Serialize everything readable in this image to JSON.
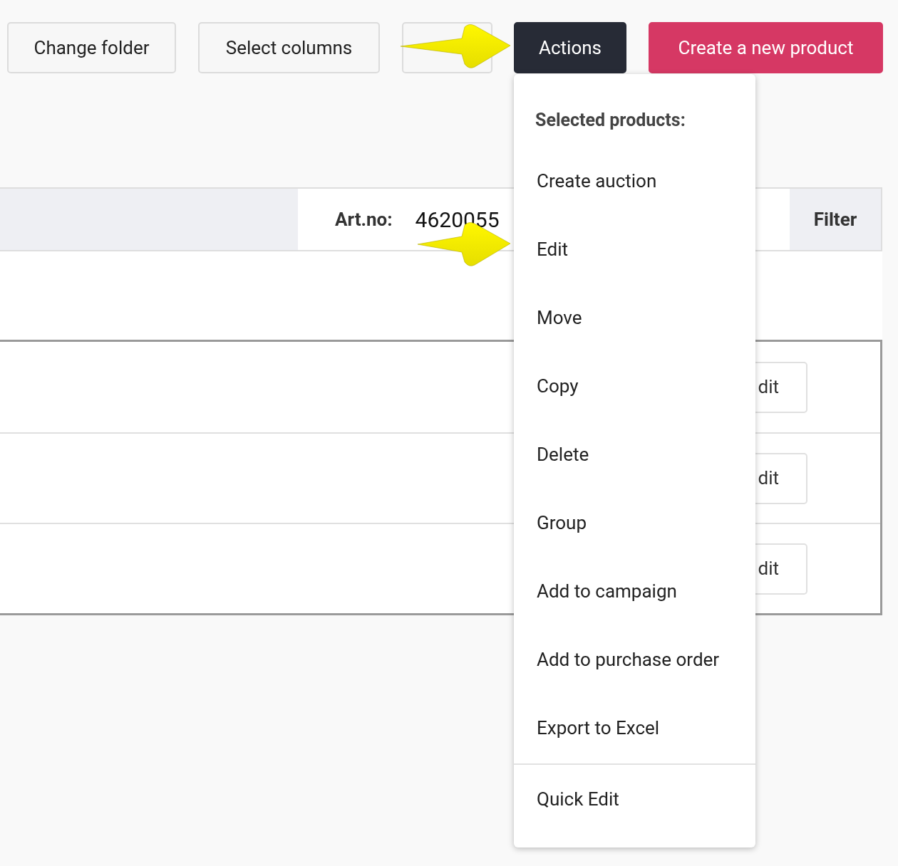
{
  "toolbar": {
    "buttons": [
      {
        "label": "Change folder",
        "kind": "plain"
      },
      {
        "label": "Select columns",
        "kind": "plain"
      },
      {
        "kind": "covered"
      },
      {
        "label": "Actions",
        "kind": "dark"
      },
      {
        "label": "Create a new product",
        "kind": "primary"
      }
    ]
  },
  "filter_bar": {
    "field_label": "Art.no:",
    "field_value": "4620055",
    "button": "Filter"
  },
  "table": {
    "rows": [
      {
        "action": "dit"
      },
      {
        "action": "dit"
      },
      {
        "action": "dit"
      }
    ]
  },
  "actions_menu": {
    "heading": "Selected products:",
    "items": [
      {
        "label": "Create auction",
        "kind": "item"
      },
      {
        "label": "Edit",
        "kind": "item"
      },
      {
        "label": "Move",
        "kind": "item"
      },
      {
        "label": "Copy",
        "kind": "item"
      },
      {
        "label": "Delete",
        "kind": "item"
      },
      {
        "label": "Group",
        "kind": "item"
      },
      {
        "label": "Add to campaign",
        "kind": "item"
      },
      {
        "label": "Add to purchase order",
        "kind": "item"
      },
      {
        "label": "Export to Excel",
        "kind": "item"
      },
      {
        "label": "Quick Edit",
        "kind": "separated"
      }
    ]
  }
}
